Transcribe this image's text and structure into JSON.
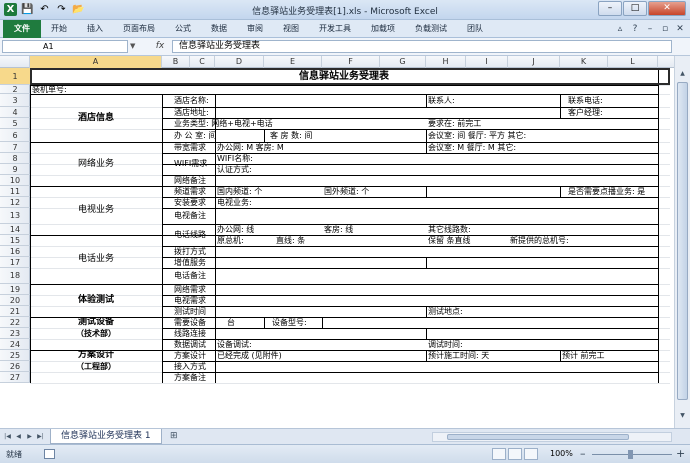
{
  "window": {
    "title": "信息驿站业务受理表[1].xls - Microsoft Excel",
    "buttons": {
      "minimize": "–",
      "maximize": "□",
      "close": "✕"
    }
  },
  "qat": {
    "logo": "X",
    "save_icon": "save-icon",
    "undo_icon": "undo-icon",
    "redo_icon": "redo-icon",
    "open_icon": "folder-icon"
  },
  "ribbon": {
    "tabs": [
      "文件",
      "开始",
      "插入",
      "页面布局",
      "公式",
      "数据",
      "审阅",
      "视图",
      "开发工具",
      "加载项",
      "负载测试",
      "团队"
    ]
  },
  "formula_bar": {
    "name_box": "A1",
    "fx": "fx",
    "content": "信息驿站业务受理表"
  },
  "columns": [
    "A",
    "B",
    "C",
    "D",
    "E",
    "F",
    "G",
    "H",
    "I",
    "J",
    "K",
    "L"
  ],
  "rows": [
    "1",
    "2",
    "3",
    "4",
    "5",
    "6",
    "7",
    "8",
    "9",
    "10",
    "11",
    "12",
    "13",
    "14",
    "15",
    "16",
    "17",
    "18",
    "19",
    "20",
    "21",
    "22",
    "23",
    "24",
    "25",
    "26",
    "27"
  ],
  "sheet": {
    "title": "信息驿站业务受理表",
    "r2_a": "装机单号:",
    "hotel": {
      "label": "酒店信息",
      "name": "酒店名称:",
      "contact": "联系人:",
      "phone": "联系电话:",
      "address": "酒店地址:",
      "manager": "客户经理:",
      "biz_type": "业务类型: 网络+电视+电话",
      "deadline": "要求在:  前完工",
      "office": "办  公  室:    间",
      "rooms": "客  房  数:    间",
      "meeting": "会议室:    间  餐厅:     平方  其它:"
    },
    "network": {
      "label": "网络业务",
      "bw_req": "带宽需求",
      "bw_office": "办公网:   M  客房:    M",
      "bw_meeting": "会议室:   M    餐厅:    M   其它:",
      "wifi_req": "WIFI需求",
      "wifi_name": "WIFI名称:",
      "auth": "认证方式:",
      "remark": "网络备注"
    },
    "tv": {
      "label": "电视业务",
      "channel_req": "频道需求",
      "domestic": "国内频道:    个",
      "foreign": "国外频道:    个",
      "carousel": "是否需要点播业务: 是",
      "install_req": "安装要求",
      "tv_biz": "电视业务:",
      "remark": "电视备注"
    },
    "phone": {
      "label": "电话业务",
      "lines": "电话线路",
      "office_line": "办公网:     线",
      "room_line": "客房:     线",
      "other_lines": "其它线路数:",
      "pbx": "原总机:",
      "direct": "直线:     条",
      "keep": "保留   条直线",
      "new_pbx": "新提供的总机号:",
      "dial": "拨打方式",
      "value_add": "增值服务",
      "remark": "电话备注"
    },
    "trial": {
      "label": "体验测试",
      "net_req": "网络需求",
      "tv_req": "电视需求",
      "time": "测试时间",
      "place": "测试地点:"
    },
    "equipment": {
      "label1": "测试设备",
      "label2": "（技术部）",
      "need": "需要设备",
      "units": "台",
      "model": "设备型号:",
      "line_conn": "线路连接",
      "debug": "数据调试",
      "debug_equip": "设备调试:",
      "debug_time": "调试时间:"
    },
    "plan": {
      "label1": "方案设计",
      "label2": "（工程部）",
      "design": "方案设计",
      "done": "已经完成 (见附件)",
      "est_time": "预计施工时间:    天",
      "est_done": "预计   前完工",
      "access": "接入方式",
      "plan_remark": "方案备注"
    }
  },
  "sheet_tab": "信息驿站业务受理表 1",
  "status": {
    "ready": "就绪",
    "zoom": "100%",
    "minus": "–",
    "plus": "+"
  }
}
